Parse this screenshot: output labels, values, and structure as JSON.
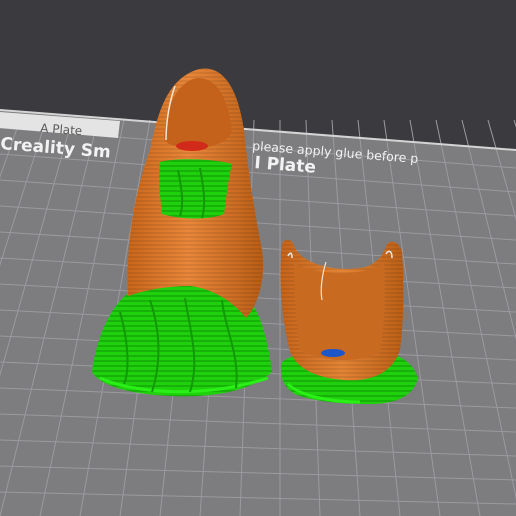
{
  "viewport": {
    "plate_tab_label": "A Plate",
    "plate_name": "Creality Smooth PEI Plate",
    "plate_name_visible": "Creality Sm",
    "plate_name_tail": "I Plate",
    "plate_notice": "please apply glue before p"
  },
  "colors": {
    "background": "#3b3b3f",
    "bed": "#7d7d80",
    "grid_line": "#95959a",
    "bed_edge": "#d6d6d6",
    "support_green": "#22d90d",
    "model_orange": "#d9761f",
    "model_orange_dark": "#b35a12"
  },
  "objects": [
    {
      "name": "Tall finger cap model",
      "color": "model_orange",
      "support_color": "support_green"
    },
    {
      "name": "Short open cup model",
      "color": "model_orange",
      "support_color": "support_green"
    }
  ]
}
